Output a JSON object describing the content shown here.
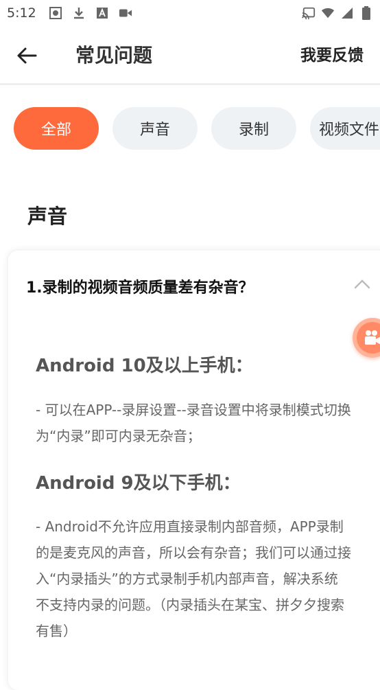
{
  "status_bar": {
    "time": "5:12"
  },
  "header": {
    "title": "常见问题",
    "feedback": "我要反馈"
  },
  "tabs": [
    {
      "label": "全部",
      "active": true
    },
    {
      "label": "声音",
      "active": false
    },
    {
      "label": "录制",
      "active": false
    },
    {
      "label": "视频文件",
      "active": false
    }
  ],
  "section": {
    "title": "声音"
  },
  "faq": {
    "question": "1.录制的视频音频质量差有杂音？",
    "heading_1": "Android 10及以上手机：",
    "text_1": "- 可以在APP--录屏设置--录音设置中将录制模式切换为“内录”即可内录无杂音；",
    "heading_2": "Android 9及以下手机：",
    "text_2": "- Android不允许应用直接录制内部音频，APP录制的是麦克风的声音，所以会有杂音；我们可以通过接入“内录插头”的方式录制手机内部声音，解决系统不支持内录的问题。（内录插头在某宝、拼夕夕搜索有售）"
  },
  "colors": {
    "accent": "#ff6a3d",
    "chip_bg": "#eff2f5"
  },
  "icons": [
    "back-arrow-icon",
    "chevron-up-icon",
    "video-camera-icon",
    "record-icon",
    "download-icon",
    "a-icon",
    "cast-icon",
    "wifi-icon",
    "signal-icon",
    "battery-icon"
  ]
}
